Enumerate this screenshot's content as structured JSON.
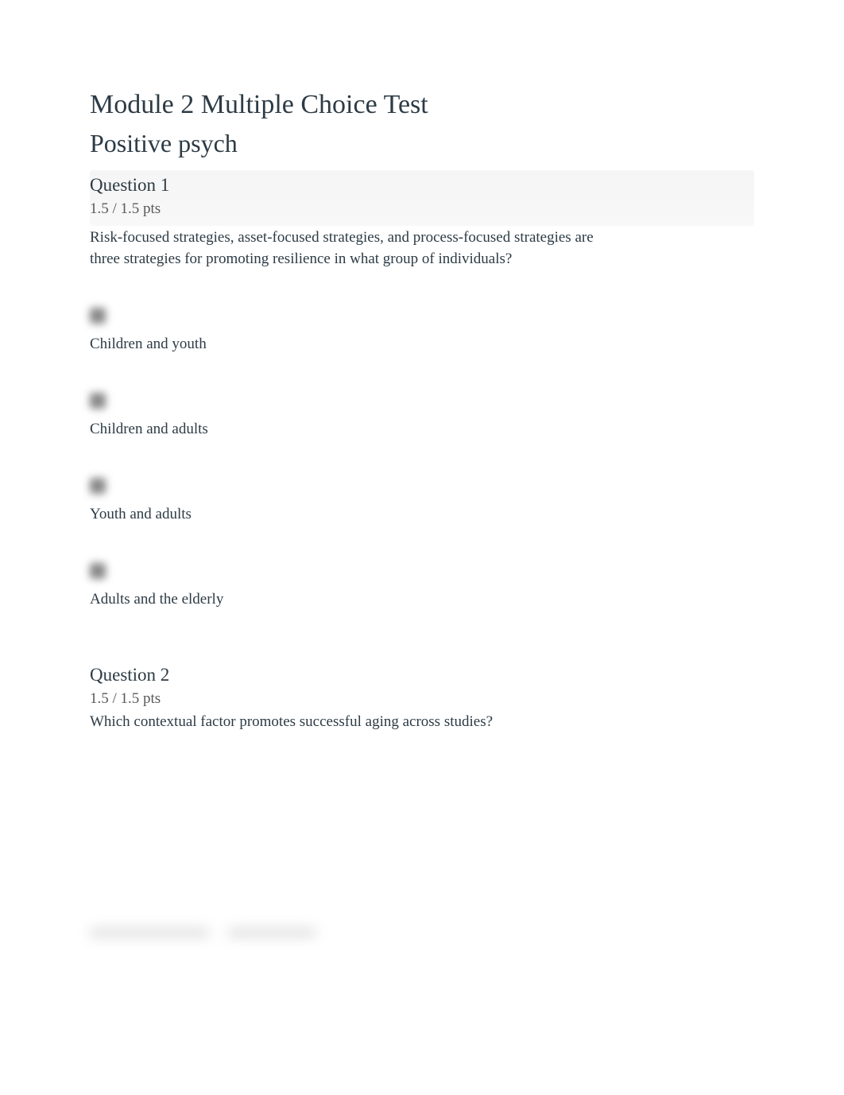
{
  "title": "Module 2 Multiple Choice Test",
  "subtitle": "Positive psych",
  "question1": {
    "label": "Question 1",
    "points": "1.5 / 1.5 pts",
    "text": "Risk-focused strategies, asset-focused strategies, and process-focused strategies are three strategies for promoting resilience in what group of individuals?",
    "answers": [
      "Children and youth",
      "Children and adults",
      "Youth and adults",
      "Adults and the elderly"
    ]
  },
  "question2": {
    "label": "Question 2",
    "points": "1.5 / 1.5 pts",
    "text": "Which contextual factor promotes successful aging across studies?"
  }
}
